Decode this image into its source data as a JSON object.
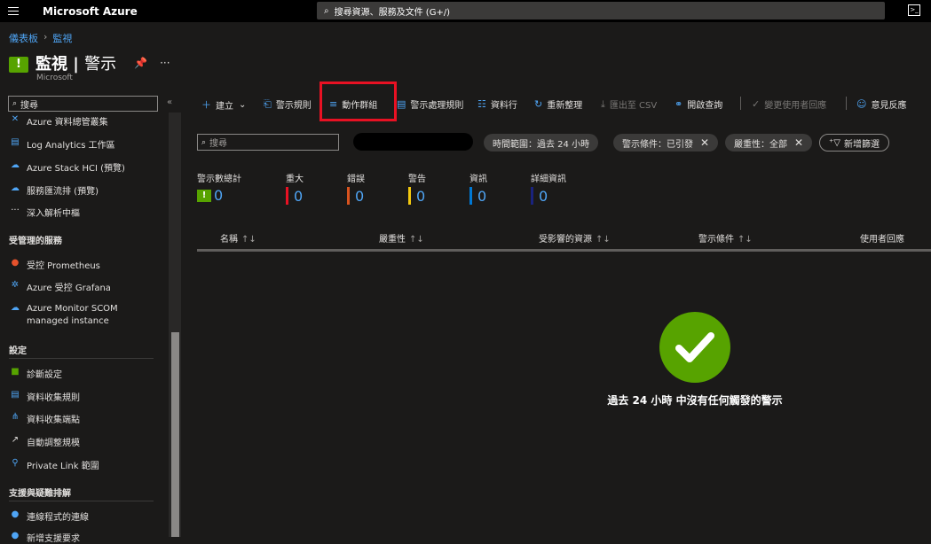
{
  "topbar": {
    "brand": "Microsoft Azure",
    "search_placeholder": "搜尋資源、服務及文件 (G+/)"
  },
  "breadcrumb": [
    "儀表板",
    "監視"
  ],
  "page": {
    "title_main": "監視",
    "title_sub": "警示",
    "subtitle": "Microsoft"
  },
  "sidebar": {
    "search_placeholder": "搜尋",
    "items": [
      {
        "label": "Azure 資料總管叢集",
        "icon": "database-icon"
      },
      {
        "label": "Log Analytics 工作區",
        "icon": "workspace-icon"
      },
      {
        "label": "Azure Stack HCI (預覽)",
        "icon": "cloud-icon"
      },
      {
        "label": "服務匯流排 (預覽)",
        "icon": "service-bus-icon"
      },
      {
        "label": "深入解析中樞",
        "icon": "ellipsis-icon"
      }
    ],
    "section_managed": "受管理的服務",
    "managed_items": [
      {
        "label": "受控 Prometheus",
        "icon": "prometheus-icon"
      },
      {
        "label": "Azure 受控 Grafana",
        "icon": "grafana-icon"
      },
      {
        "label": "Azure Monitor SCOM",
        "label2": "managed instance",
        "icon": "scom-icon"
      }
    ],
    "section_settings": "設定",
    "settings_items": [
      {
        "label": "診斷設定",
        "icon": "diagnostic-icon"
      },
      {
        "label": "資料收集規則",
        "icon": "data-rule-icon"
      },
      {
        "label": "資料收集端點",
        "icon": "endpoint-icon"
      },
      {
        "label": "自動調整規模",
        "icon": "autoscale-icon"
      },
      {
        "label": "Private Link 範圍",
        "icon": "private-link-icon"
      }
    ],
    "section_support": "支援與疑難排解",
    "support_items": [
      {
        "label": "連線程式的連線",
        "icon": "globe-icon"
      },
      {
        "label": "新增支援要求",
        "icon": "support-icon"
      }
    ]
  },
  "toolbar": {
    "create": "建立",
    "alert_rules": "警示規則",
    "action_groups": "動作群組",
    "processing_rules": "警示處理規則",
    "columns": "資料行",
    "refresh": "重新整理",
    "export_csv": "匯出至 CSV",
    "open_query": "開啟查詢",
    "change_user_response": "變更使用者回應",
    "feedback": "意見反應"
  },
  "filters": {
    "search_placeholder": "搜尋",
    "time_range": "時間範圍：過去 24 小時",
    "alert_condition": "警示條件：已引發",
    "severity": "嚴重性：全部",
    "add_filter": "新增篩選"
  },
  "stats": [
    {
      "label": "警示數總計",
      "value": "0",
      "color": "#57a300"
    },
    {
      "label": "重大",
      "value": "0",
      "color": "#e81123"
    },
    {
      "label": "錯誤",
      "value": "0",
      "color": "#d9531e"
    },
    {
      "label": "警告",
      "value": "0",
      "color": "#f2c80f"
    },
    {
      "label": "資訊",
      "value": "0",
      "color": "#0078d4"
    },
    {
      "label": "詳細資訊",
      "value": "0",
      "color": "#1a237e"
    }
  ],
  "columns": [
    "名稱",
    "嚴重性",
    "受影響的資源",
    "警示條件",
    "使用者回應"
  ],
  "empty_message": "過去 24 小時 中沒有任何觸發的警示"
}
